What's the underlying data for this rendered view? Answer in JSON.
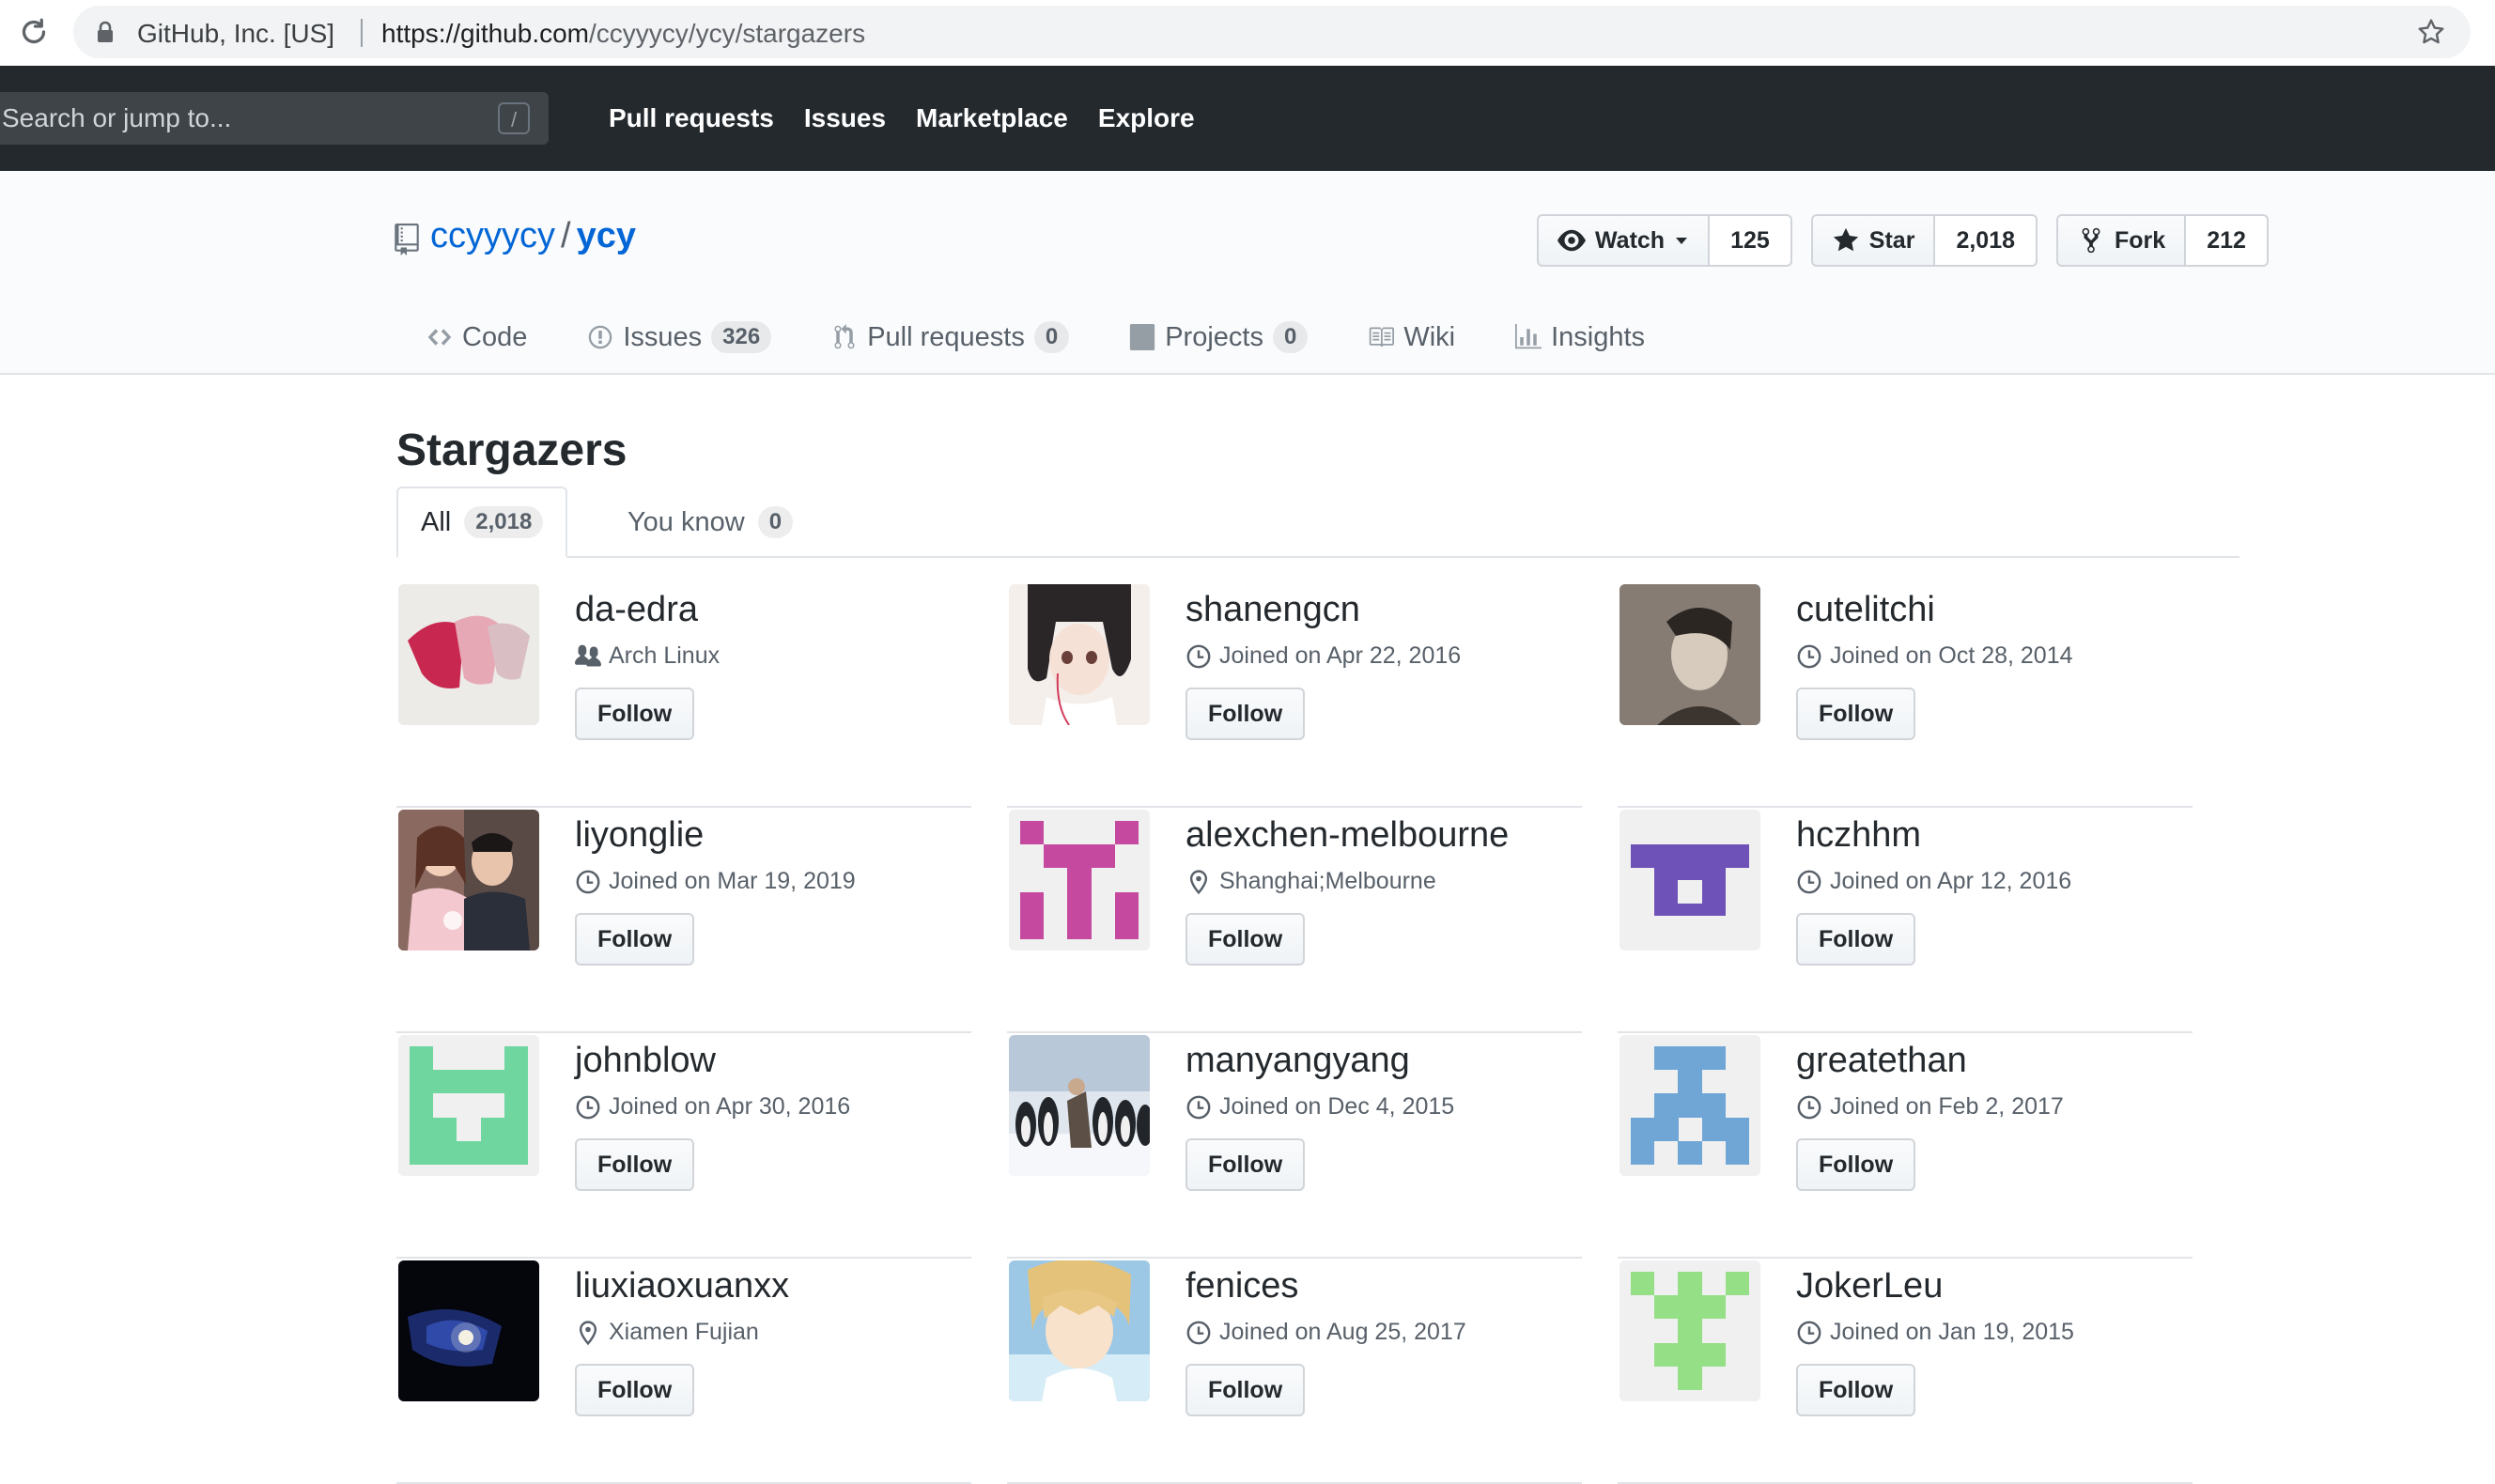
{
  "browser": {
    "site_identity": "GitHub, Inc. [US]",
    "url_host": "https://github.com",
    "url_path": "/ccyyycy/ycy/stargazers"
  },
  "header": {
    "search_placeholder": "Search or jump to...",
    "slash_key": "/",
    "nav": [
      "Pull requests",
      "Issues",
      "Marketplace",
      "Explore"
    ]
  },
  "repo": {
    "owner": "ccyyycy",
    "separator": "/",
    "name": "ycy",
    "watch_label": "Watch",
    "watch_count": "125",
    "star_label": "Star",
    "star_count": "2,018",
    "fork_label": "Fork",
    "fork_count": "212",
    "tabs": [
      {
        "label": "Code",
        "icon": "code-icon"
      },
      {
        "label": "Issues",
        "count": "326",
        "icon": "issue-icon"
      },
      {
        "label": "Pull requests",
        "count": "0",
        "icon": "pull-request-icon"
      },
      {
        "label": "Projects",
        "count": "0",
        "icon": "project-icon"
      },
      {
        "label": "Wiki",
        "icon": "book-icon"
      },
      {
        "label": "Insights",
        "icon": "graph-icon"
      }
    ]
  },
  "main": {
    "title": "Stargazers",
    "subnav": {
      "all_label": "All",
      "all_count": "2,018",
      "you_know_label": "You know",
      "you_know_count": "0"
    },
    "follow_label": "Follow",
    "users": [
      {
        "name": "da-edra",
        "meta": "Arch Linux",
        "meta_icon": "organization-icon"
      },
      {
        "name": "shanengcn",
        "meta": "Joined on Apr 22, 2016",
        "meta_icon": "clock-icon"
      },
      {
        "name": "cutelitchi",
        "meta": "Joined on Oct 28, 2014",
        "meta_icon": "clock-icon"
      },
      {
        "name": "liyonglie",
        "meta": "Joined on Mar 19, 2019",
        "meta_icon": "clock-icon"
      },
      {
        "name": "alexchen-melbourne",
        "meta": "Shanghai;Melbourne",
        "meta_icon": "location-icon"
      },
      {
        "name": "hczhhm",
        "meta": "Joined on Apr 12, 2016",
        "meta_icon": "clock-icon"
      },
      {
        "name": "johnblow",
        "meta": "Joined on Apr 30, 2016",
        "meta_icon": "clock-icon"
      },
      {
        "name": "manyangyang",
        "meta": "Joined on Dec 4, 2015",
        "meta_icon": "clock-icon"
      },
      {
        "name": "greatethan",
        "meta": "Joined on Feb 2, 2017",
        "meta_icon": "clock-icon"
      },
      {
        "name": "liuxiaoxuanxx",
        "meta": "Xiamen Fujian",
        "meta_icon": "location-icon"
      },
      {
        "name": "fenices",
        "meta": "Joined on Aug 25, 2017",
        "meta_icon": "clock-icon"
      },
      {
        "name": "JokerLeu",
        "meta": "Joined on Jan 19, 2015",
        "meta_icon": "clock-icon"
      }
    ]
  }
}
